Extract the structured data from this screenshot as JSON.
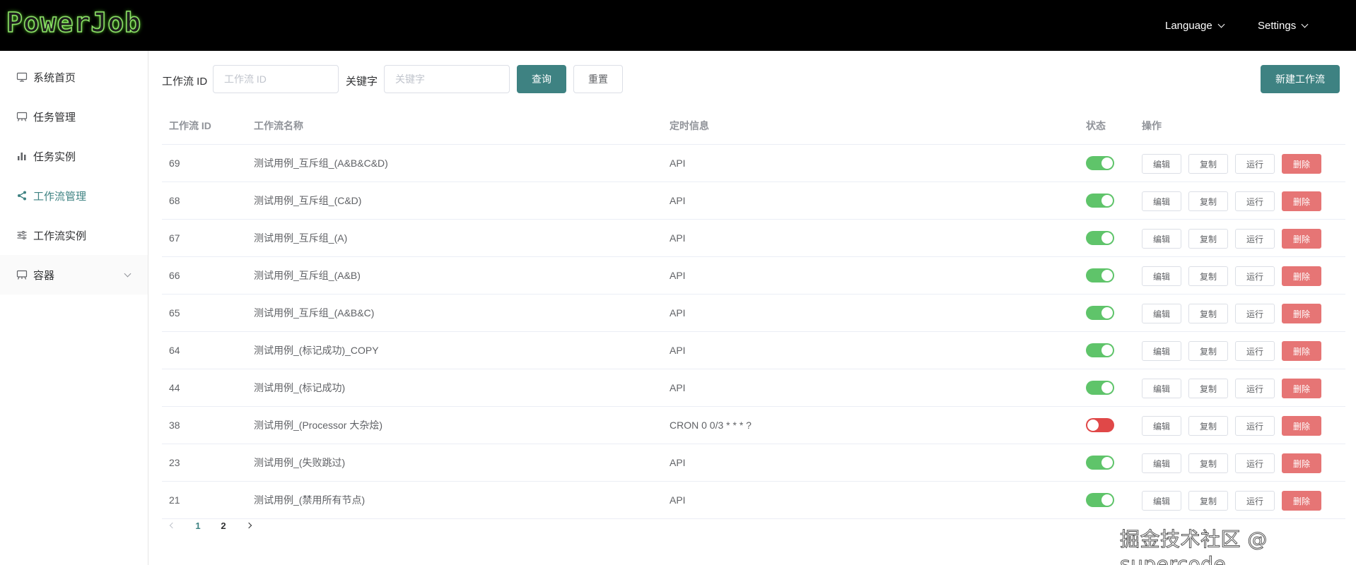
{
  "header": {
    "logo": "PowerJob",
    "language_label": "Language",
    "settings_label": "Settings"
  },
  "sidebar": {
    "items": [
      {
        "label": "系统首页",
        "icon": "monitor-icon"
      },
      {
        "label": "任务管理",
        "icon": "task-board-icon"
      },
      {
        "label": "任务实例",
        "icon": "bar-chart-icon"
      },
      {
        "label": "工作流管理",
        "icon": "share-icon"
      },
      {
        "label": "工作流实例",
        "icon": "sliders-icon"
      },
      {
        "label": "容器",
        "icon": "container-icon"
      }
    ],
    "active_item": "工作流管理"
  },
  "search": {
    "id_label": "工作流 ID",
    "id_placeholder": "工作流 ID",
    "keyword_label": "关键字",
    "keyword_placeholder": "关键字",
    "query_button": "查询",
    "reset_button": "重置",
    "new_button": "新建工作流"
  },
  "table": {
    "headers": {
      "id": "工作流 ID",
      "name": "工作流名称",
      "time": "定时信息",
      "status": "状态",
      "ops": "操作"
    },
    "op_labels": {
      "edit": "编辑",
      "copy": "复制",
      "run": "运行",
      "delete": "删除"
    },
    "rows": [
      {
        "id": "69",
        "name": "测试用例_互斥组_(A&B&C&D)",
        "time": "API",
        "enabled": true
      },
      {
        "id": "68",
        "name": "测试用例_互斥组_(C&D)",
        "time": "API",
        "enabled": true
      },
      {
        "id": "67",
        "name": "测试用例_互斥组_(A)",
        "time": "API",
        "enabled": true
      },
      {
        "id": "66",
        "name": "测试用例_互斥组_(A&B)",
        "time": "API",
        "enabled": true
      },
      {
        "id": "65",
        "name": "测试用例_互斥组_(A&B&C)",
        "time": "API",
        "enabled": true
      },
      {
        "id": "64",
        "name": "测试用例_(标记成功)_COPY",
        "time": "API",
        "enabled": true
      },
      {
        "id": "44",
        "name": "测试用例_(标记成功)",
        "time": "API",
        "enabled": true
      },
      {
        "id": "38",
        "name": "测试用例_(Processor 大杂烩)",
        "time": "CRON 0 0/3 * * * ?",
        "enabled": false
      },
      {
        "id": "23",
        "name": "测试用例_(失败跳过)",
        "time": "API",
        "enabled": true
      },
      {
        "id": "21",
        "name": "测试用例_(禁用所有节点)",
        "time": "API",
        "enabled": true
      }
    ]
  },
  "pagination": {
    "pages": [
      "1",
      "2"
    ],
    "current": "1"
  },
  "colors": {
    "primary": "#3e8282",
    "switch_on": "#5fc46a",
    "switch_off": "#e04848",
    "danger": "#e67575"
  },
  "watermark": "掘金技术社区 @ supercode"
}
